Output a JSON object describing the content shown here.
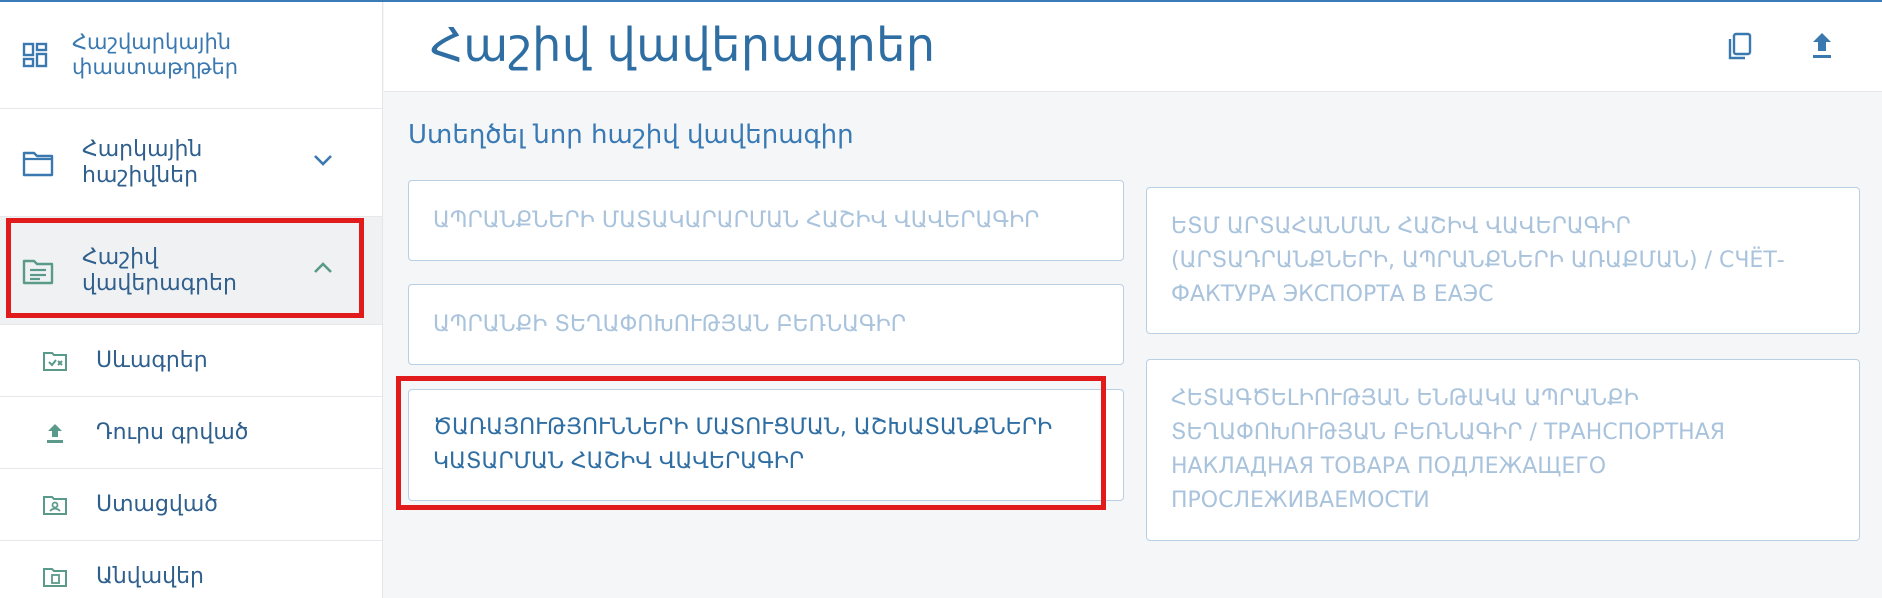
{
  "sidebar": {
    "header_label": "Հաշվարկային փաստաթղթեր",
    "items": [
      {
        "label": "Հարկային հաշիվներ",
        "icon": "folder-icon",
        "expanded": false
      },
      {
        "label": "Հաշիվ վավերագրեր",
        "icon": "folder-open-document-icon",
        "expanded": true
      }
    ],
    "sub_items": [
      {
        "label": "Սևագրեր",
        "icon": "drafts-folder-icon"
      },
      {
        "label": "Դուրս գրված",
        "icon": "upload-icon"
      },
      {
        "label": "Ստացված",
        "icon": "received-folder-icon"
      },
      {
        "label": "Անվավեր",
        "icon": "invalid-folder-icon"
      }
    ]
  },
  "header": {
    "title": "Հաշիվ վավերագրեր",
    "copy_icon": "copy-icon",
    "upload_icon": "upload-icon"
  },
  "main": {
    "section_title": "Ստեղծել նոր հաշիվ վավերագիր",
    "cards_left": [
      "ԱՊՐԱՆՔՆԵՐԻ ՄԱՏԱԿԱՐԱՐՄԱՆ ՀԱՇԻՎ ՎԱՎԵՐԱԳԻՐ",
      "ԱՊՐԱՆՔԻ ՏԵՂԱՓՈԽՈՒԹՅԱՆ ԲԵՌՆԱԳԻՐ",
      "ԾԱՌԱՅՈՒԹՅՈՒՆՆԵՐԻ ՄԱՏՈՒՑՄԱՆ, ԱՇԽԱՏԱՆՔՆԵՐԻ ԿԱՏԱՐՄԱՆ ՀԱՇԻՎ ՎԱՎԵՐԱԳԻՐ"
    ],
    "cards_right": [
      "ԵՏՄ ԱՐՏԱՀԱՆՄԱՆ ՀԱՇԻՎ ՎԱՎԵՐԱԳԻՐ (ԱՐՏԱԴՐԱՆՔՆԵՐԻ, ԱՊՐԱՆՔՆԵՐԻ ԱՌԱՔՄԱՆ) / СЧЁТ-ФАКТУРА ЭКСПОРТА В ЕАЭС",
      "ՀԵՏԱԳԾԵԼԻՈՒԹՅԱՆ ԵՆԹԱԿԱ ԱՊՐԱՆՔԻ ՏԵՂԱՓՈԽՈՒԹՅԱՆ ԲԵՌՆԱԳԻՐ / ТРАНСПОРТНАЯ НАКЛАДНАЯ ТОВАРА ПОДЛЕЖАЩЕГО ПРОСЛЕЖИВАЕМОСТИ"
    ]
  },
  "colors": {
    "accent": "#2f6ea3",
    "highlight": "#e11b1b",
    "icon_green": "#5a9a8a"
  }
}
